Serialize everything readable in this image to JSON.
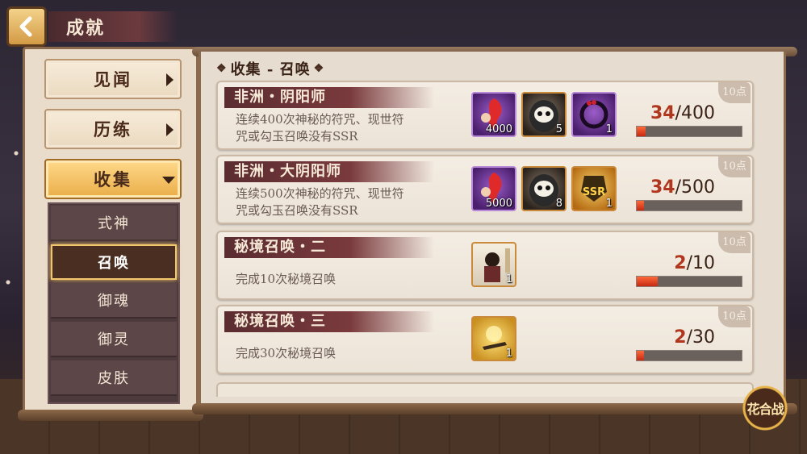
{
  "header": {
    "title": "成就"
  },
  "categories": [
    {
      "label": "见闻",
      "active": false
    },
    {
      "label": "历练",
      "active": false
    },
    {
      "label": "收集",
      "active": true
    }
  ],
  "sub_categories": [
    {
      "label": "式神",
      "active": false
    },
    {
      "label": "召唤",
      "active": true
    },
    {
      "label": "御魂",
      "active": false
    },
    {
      "label": "御灵",
      "active": false
    },
    {
      "label": "皮肤",
      "active": false
    }
  ],
  "section": {
    "title": "收集 - 召唤"
  },
  "achievements": [
    {
      "name": "非洲・阴阳师",
      "desc_line1": "连续400次神秘的符咒、现世符",
      "desc_line2": "咒或勾玉召唤没有SSR",
      "points": "10点",
      "rewards": [
        {
          "icon": "red-talisman-icon",
          "count": "4000",
          "style": "purple"
        },
        {
          "icon": "daruma-icon",
          "count": "5",
          "style": "dark"
        },
        {
          "icon": "purple-ring-icon",
          "count": "1",
          "style": "purple"
        }
      ],
      "current": "34",
      "total": "/400",
      "progress": 0.085
    },
    {
      "name": "非洲・大阴阳师",
      "desc_line1": "连续500次神秘的符咒、现世符",
      "desc_line2": "咒或勾玉召唤没有SSR",
      "points": "10点",
      "rewards": [
        {
          "icon": "red-talisman-icon",
          "count": "5000",
          "style": "purple"
        },
        {
          "icon": "daruma-icon",
          "count": "8",
          "style": "dark"
        },
        {
          "icon": "ssr-frame-icon",
          "count": "1",
          "style": "gold"
        }
      ],
      "current": "34",
      "total": "/500",
      "progress": 0.068
    },
    {
      "name": "秘境召唤・二",
      "desc_line1": "完成10次秘境召唤",
      "points": "10点",
      "rewards": [
        {
          "icon": "character-portrait-icon",
          "count": "1",
          "style": "light"
        }
      ],
      "current": "2",
      "total": "/10",
      "progress": 0.2
    },
    {
      "name": "秘境召唤・三",
      "desc_line1": "完成30次秘境召唤",
      "points": "10点",
      "rewards": [
        {
          "icon": "glowing-portrait-icon",
          "count": "1",
          "style": "gold2"
        }
      ],
      "current": "2",
      "total": "/30",
      "progress": 0.067
    }
  ],
  "corner_badge": {
    "label": "花合战"
  }
}
